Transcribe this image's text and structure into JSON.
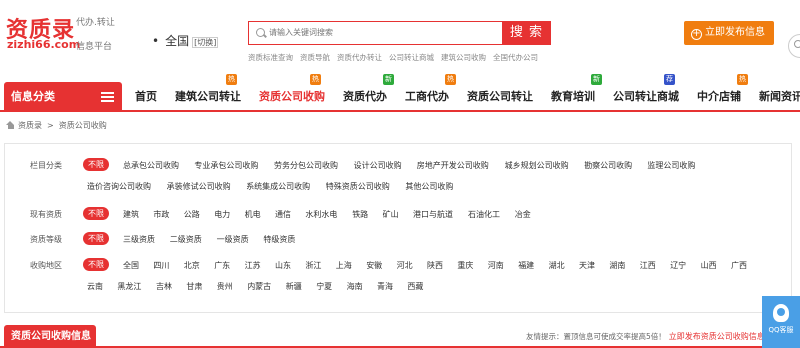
{
  "logo": {
    "main": "资质录",
    "tag1": "代办.转让",
    "domain": "zizhi66.com",
    "tag2": "信息平台"
  },
  "city": {
    "dot": "•",
    "name": "全国",
    "switch": "[切换]"
  },
  "search": {
    "placeholder": "请输入关键词搜索",
    "button": "搜 索",
    "hot_links": [
      "资质标准查询",
      "资质导航",
      "资质代办转让",
      "公司转让商城",
      "建筑公司收购",
      "全国代办公司"
    ]
  },
  "publish_button": "立即发布信息",
  "nav": {
    "category": "信息分类",
    "items": [
      {
        "label": "首页",
        "badge": ""
      },
      {
        "label": "建筑公司转让",
        "badge": "hot"
      },
      {
        "label": "资质公司收购",
        "badge": "hot",
        "active": true
      },
      {
        "label": "资质代办",
        "badge": "new"
      },
      {
        "label": "工商代办",
        "badge": "hot"
      },
      {
        "label": "资质公司转让",
        "badge": ""
      },
      {
        "label": "教育培训",
        "badge": "new"
      },
      {
        "label": "公司转让商城",
        "badge": "recommend"
      },
      {
        "label": "中介店铺",
        "badge": "hot"
      },
      {
        "label": "新闻资讯",
        "badge": ""
      }
    ],
    "badge_text": {
      "hot": "热",
      "new": "新",
      "recommend": "荐"
    }
  },
  "breadcrumb": {
    "home": "资质录",
    "sep": ">",
    "current": "资质公司收购"
  },
  "filters": [
    {
      "label": "栏目分类",
      "options": [
        "不限",
        "总承包公司收购",
        "专业承包公司收购",
        "劳务分包公司收购",
        "设计公司收购",
        "房地产开发公司收购",
        "城乡规划公司收购",
        "勘察公司收购",
        "监理公司收购",
        "造价咨询公司收购",
        "承装修试公司收购",
        "系统集成公司收购",
        "特殊资质公司收购",
        "其他公司收购"
      ]
    },
    {
      "label": "现有资质",
      "options": [
        "不限",
        "建筑",
        "市政",
        "公路",
        "电力",
        "机电",
        "通信",
        "水利水电",
        "铁路",
        "矿山",
        "港口与航道",
        "石油化工",
        "冶金"
      ]
    },
    {
      "label": "资质等级",
      "options": [
        "不限",
        "三级资质",
        "二级资质",
        "一级资质",
        "特级资质"
      ]
    },
    {
      "label": "收购地区",
      "options": [
        "不限",
        "全国",
        "四川",
        "北京",
        "广东",
        "江苏",
        "山东",
        "浙江",
        "上海",
        "安徽",
        "河北",
        "陕西",
        "重庆",
        "河南",
        "福建",
        "湖北",
        "天津",
        "湖南",
        "江西",
        "辽宁",
        "山西",
        "广西",
        "云南",
        "黑龙江",
        "吉林",
        "甘肃",
        "贵州",
        "内蒙古",
        "新疆",
        "宁夏",
        "海南",
        "青海",
        "西藏"
      ]
    }
  ],
  "bottom": {
    "title": "资质公司收购信息",
    "tip": "友情提示：置顶信息可使成交率提高5倍！",
    "link": "立即发布资质公司收购信息"
  },
  "qq_float": {
    "label": "QQ客服",
    "icon": "qq-icon"
  },
  "colors": {
    "brand_red": "#e63232",
    "orange": "#f07d0f",
    "green": "#2eaa3b",
    "blue": "#3553c9",
    "qq_blue": "#4a9fe6"
  }
}
